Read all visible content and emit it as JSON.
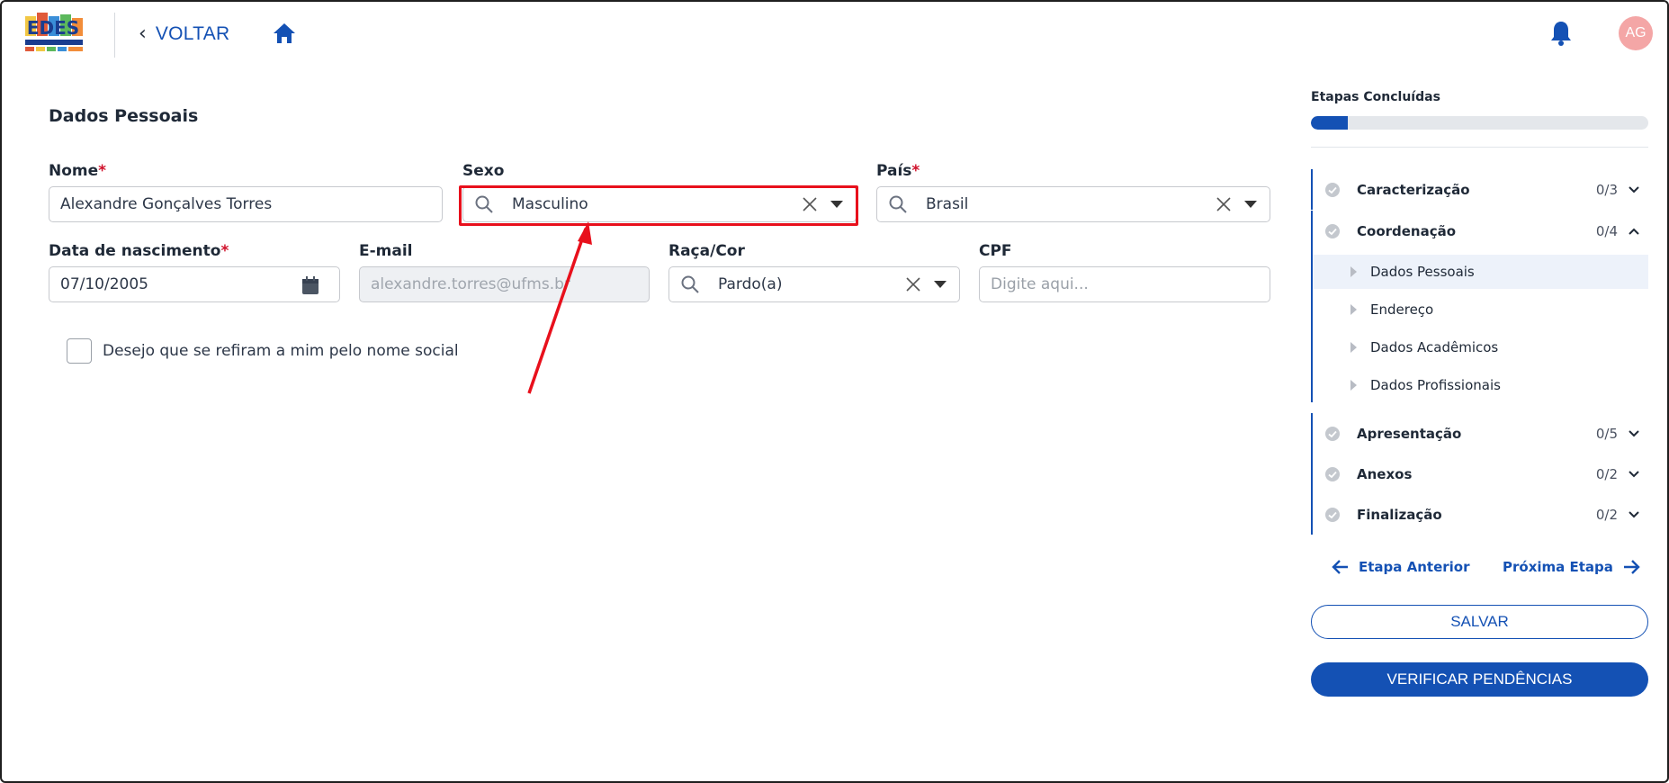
{
  "header": {
    "back_label": "VOLTAR",
    "avatar_initials": "AG"
  },
  "form": {
    "section_title": "Dados Pessoais",
    "nome": {
      "label": "Nome",
      "required_mark": "*",
      "value": "Alexandre Gonçalves Torres"
    },
    "sexo": {
      "label": "Sexo",
      "value": "Masculino"
    },
    "pais": {
      "label": "País",
      "required_mark": "*",
      "value": "Brasil"
    },
    "data_nascimento": {
      "label": "Data de nascimento",
      "required_mark": "*",
      "value": "07/10/2005"
    },
    "email": {
      "label": "E-mail",
      "value": "alexandre.torres@ufms.br"
    },
    "raca_cor": {
      "label": "Raça/Cor",
      "value": "Pardo(a)"
    },
    "cpf": {
      "label": "CPF",
      "placeholder": "Digite aqui..."
    },
    "nome_social_label": "Desejo que se refiram a mim pelo nome social"
  },
  "sidebar": {
    "title": "Etapas Concluídas",
    "progress_fraction": 0.11,
    "steps": [
      {
        "name": "Caracterização",
        "count": "0/3",
        "expanded": false
      },
      {
        "name": "Coordenação",
        "count": "0/4",
        "expanded": true,
        "substeps": [
          "Dados Pessoais",
          "Endereço",
          "Dados Acadêmicos",
          "Dados Profissionais"
        ]
      },
      {
        "name": "Apresentação",
        "count": "0/5",
        "expanded": false
      },
      {
        "name": "Anexos",
        "count": "0/2",
        "expanded": false
      },
      {
        "name": "Finalização",
        "count": "0/2",
        "expanded": false
      }
    ],
    "prev_label": "Etapa Anterior",
    "next_label": "Próxima Etapa",
    "save_label": "SALVAR",
    "verify_label": "VERIFICAR PENDÊNCIAS"
  },
  "colors": {
    "primary": "#1451b4",
    "required": "#d0102a",
    "highlight": "#e8101c",
    "avatar_bg": "#f4a6a6"
  }
}
